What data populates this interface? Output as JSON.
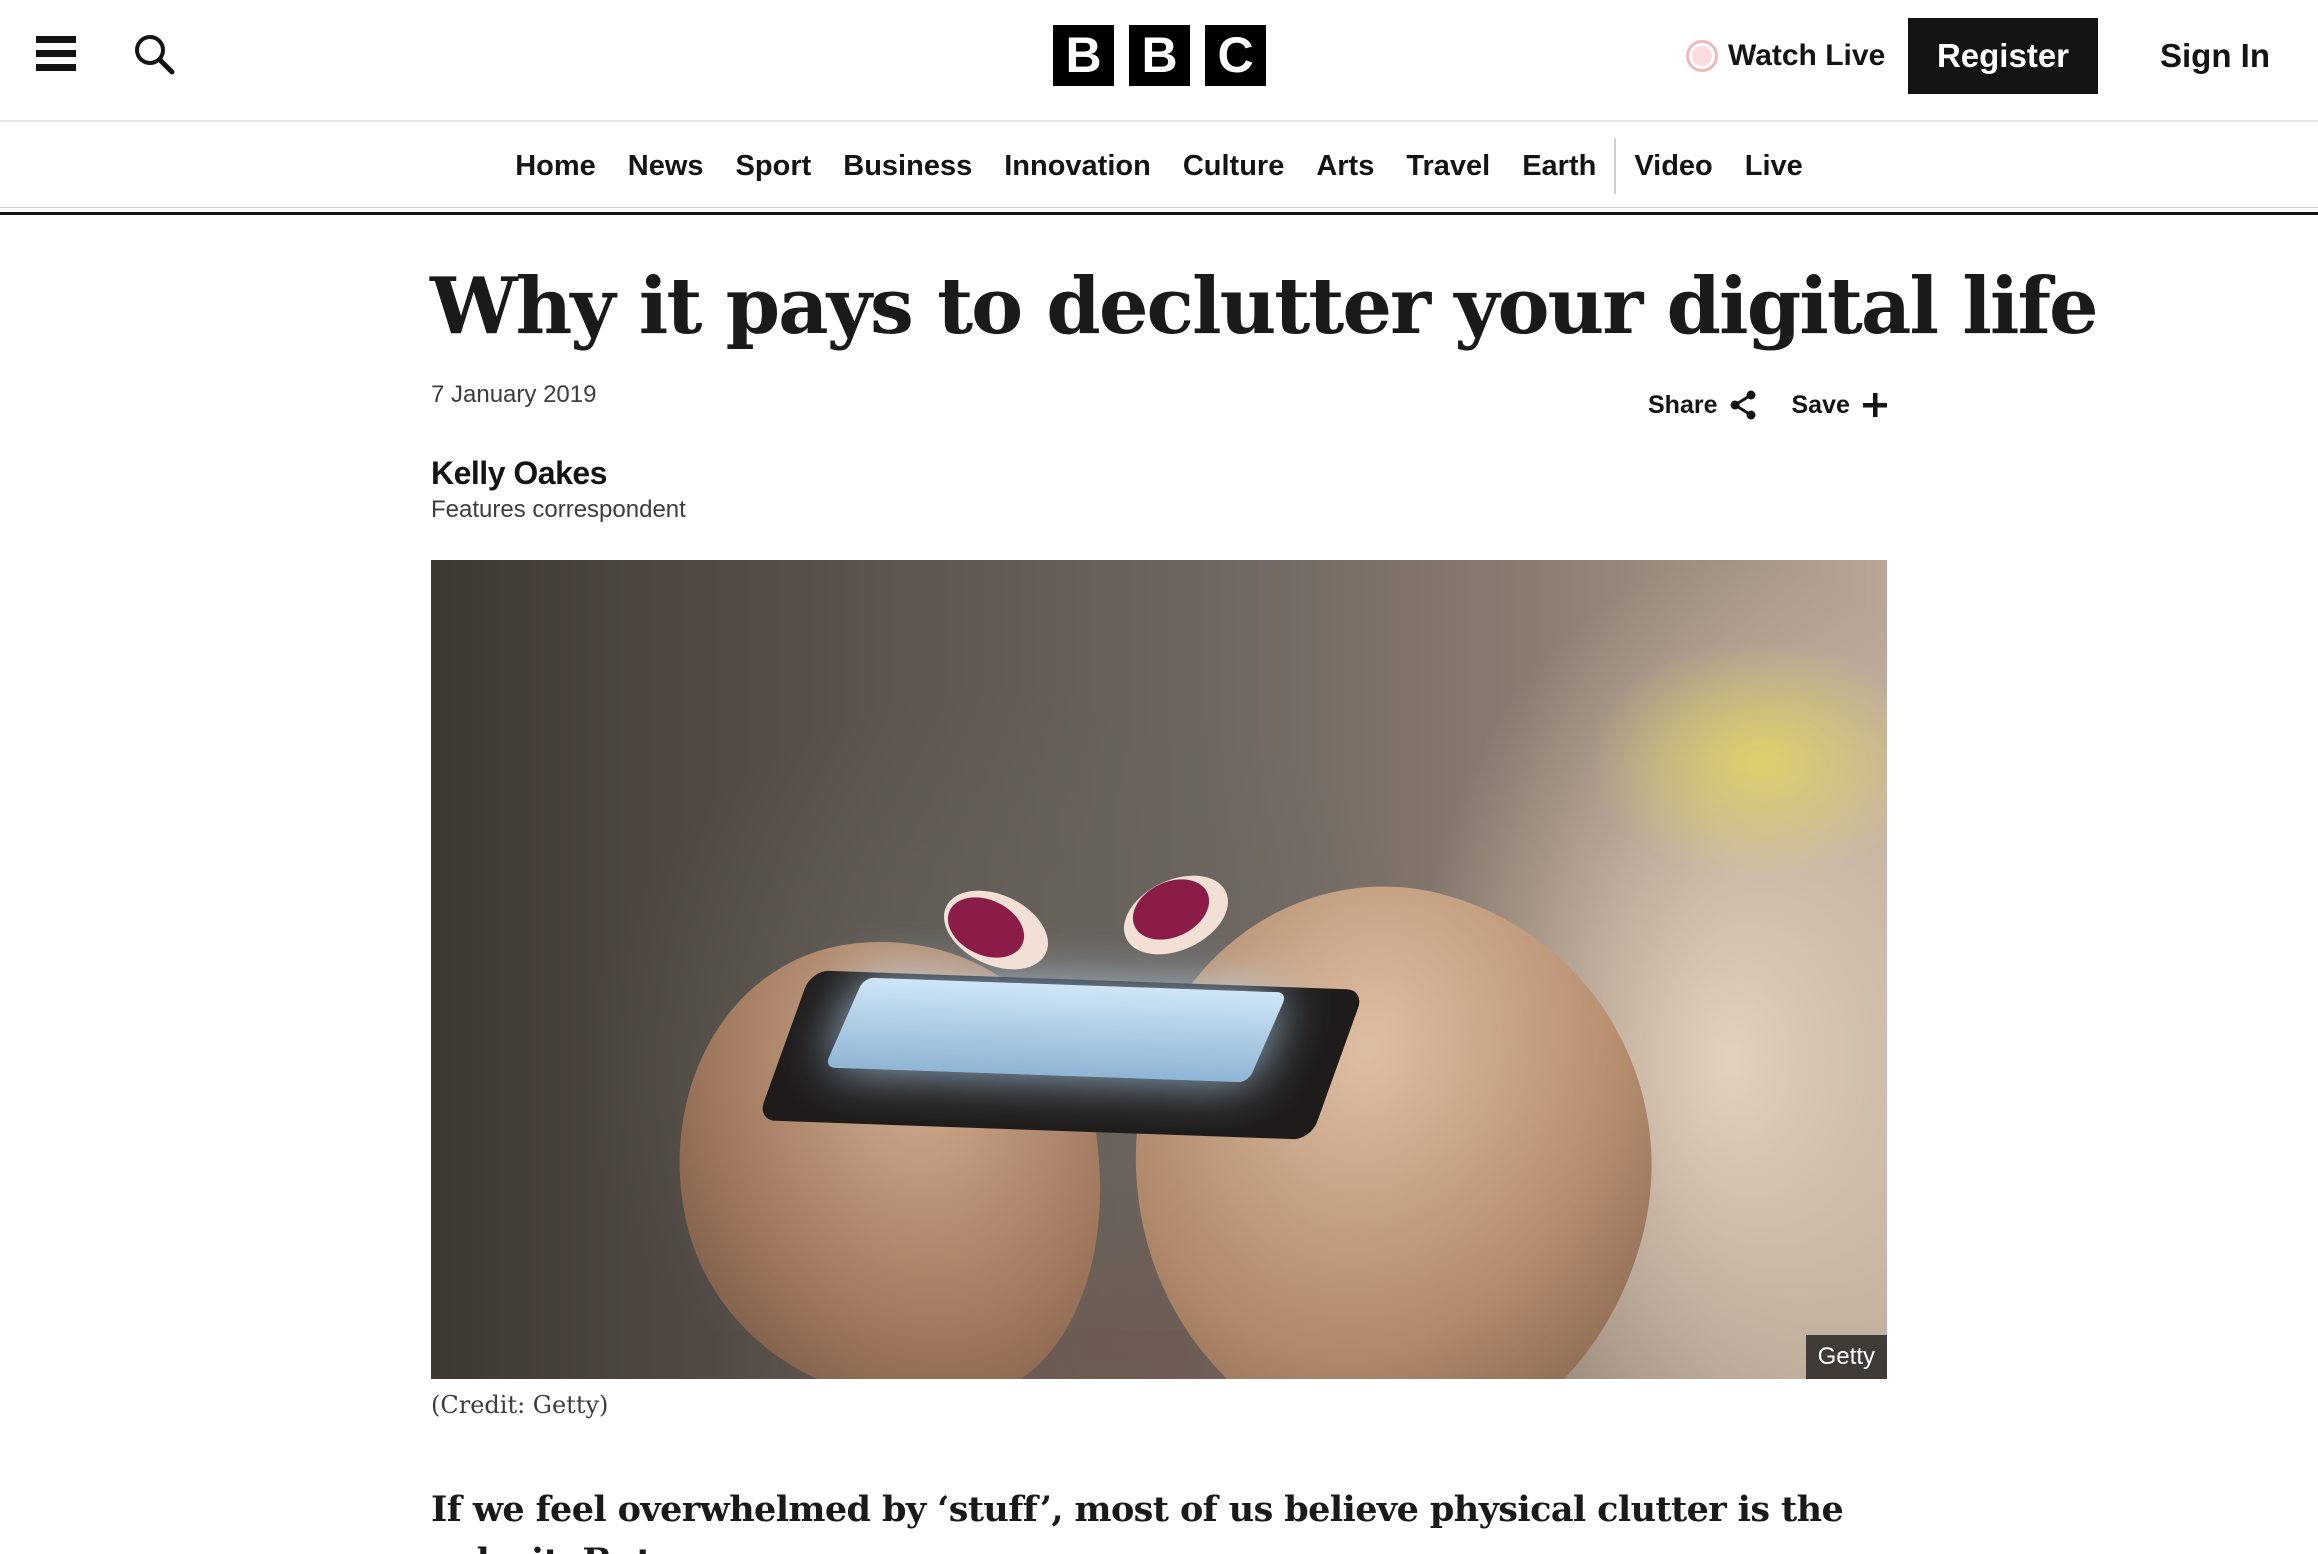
{
  "header": {
    "logo_letters": [
      "B",
      "B",
      "C"
    ],
    "watch_live_label": "Watch Live",
    "register_label": "Register",
    "sign_in_label": "Sign In",
    "icons": {
      "menu": "hamburger-menu-icon",
      "search": "search-icon",
      "live": "live-dot-icon"
    }
  },
  "nav": {
    "items": [
      "Home",
      "News",
      "Sport",
      "Business",
      "Innovation",
      "Culture",
      "Arts",
      "Travel",
      "Earth",
      "Video",
      "Live"
    ]
  },
  "article": {
    "headline": "Why it pays to declutter your digital life",
    "date": "7 January 2019",
    "share_label": "Share",
    "save_label": "Save",
    "author_name": "Kelly Oakes",
    "author_role": "Features correspondent",
    "image_credit_badge": "Getty",
    "image_caption": "(Credit: Getty)",
    "lead_paragraph": "If we feel overwhelmed by ‘stuff’, most of us believe physical clutter is the culprit. But"
  },
  "colors": {
    "text": "#141414",
    "register_bg": "#141414",
    "live_dot": "#f0b8b8",
    "meta_text": "#3d3d3d"
  }
}
